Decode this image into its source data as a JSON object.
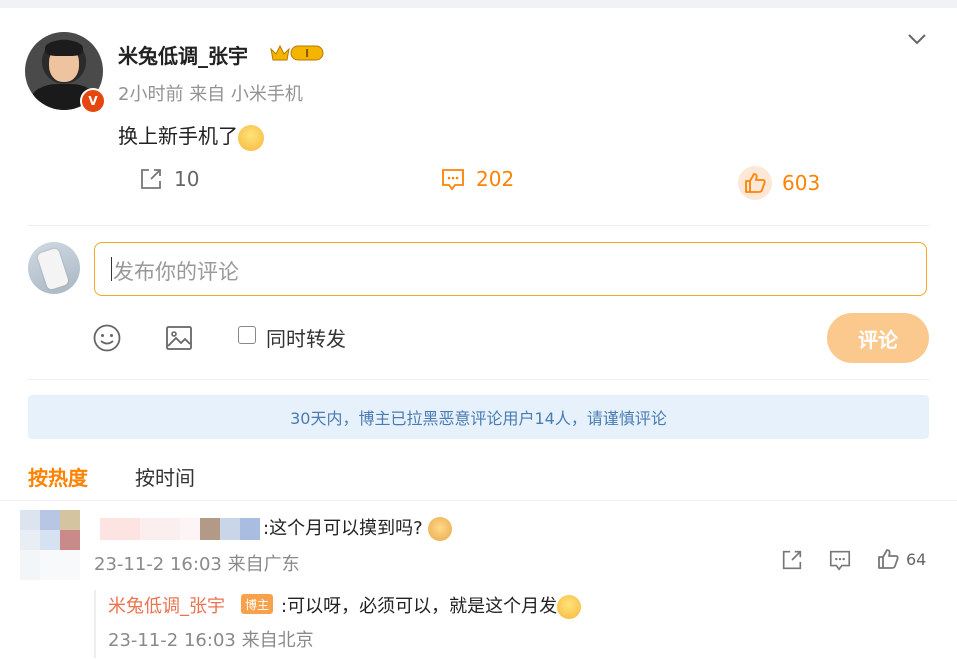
{
  "post": {
    "username": "米兔低调_张宇",
    "verified_badge": "V",
    "member_level": "I",
    "time": "2小时前",
    "source": "来自 小米手机",
    "text": "换上新手机了",
    "reposts": "10",
    "comments": "202",
    "likes": "603"
  },
  "composer": {
    "placeholder": "发布你的评论",
    "also_repost_label": "同时转发",
    "submit_label": "评论"
  },
  "notice": "30天内，博主已拉黑恶意评论用户14人，请谨慎评论",
  "sort": {
    "hot_label": "按热度",
    "time_label": "按时间"
  },
  "comment": {
    "text": ":这个月可以摸到吗?",
    "meta": "23-11-2 16:03 来自广东",
    "likes": "64"
  },
  "reply": {
    "username": "米兔低调_张宇",
    "badge": "博主",
    "text": ":可以呀，必须可以，就是这个月发",
    "meta": "23-11-2 16:03 来自北京"
  },
  "icons": [
    "chevron-down-icon",
    "repost-icon",
    "comment-icon",
    "like-icon",
    "emoji-icon",
    "image-icon",
    "crown-icon"
  ],
  "colors": {
    "accent": "#ff8200",
    "notice_bg": "#e6f1fb",
    "notice_text": "#4a7bb2",
    "submit_bg": "#fbc98e",
    "reply_user": "#eb7350"
  }
}
